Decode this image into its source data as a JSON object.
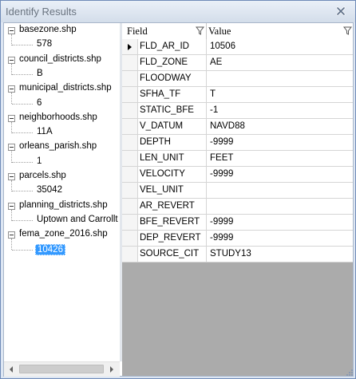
{
  "window": {
    "title": "Identify Results"
  },
  "tree": {
    "layers": [
      {
        "name": "basezone.shp",
        "value": "578"
      },
      {
        "name": "council_districts.shp",
        "value": "B"
      },
      {
        "name": "municipal_districts.shp",
        "value": "6"
      },
      {
        "name": "neighborhoods.shp",
        "value": "11A"
      },
      {
        "name": "orleans_parish.shp",
        "value": "1"
      },
      {
        "name": "parcels.shp",
        "value": "35042"
      },
      {
        "name": "planning_districts.shp",
        "value": "Uptown and Carrollt"
      },
      {
        "name": "fema_zone_2016.shp",
        "value": "10426"
      }
    ],
    "selected_index": 7
  },
  "grid": {
    "field_header": "Field",
    "value_header": "Value",
    "rows": [
      {
        "field": "FLD_AR_ID",
        "value": "10506"
      },
      {
        "field": "FLD_ZONE",
        "value": "AE"
      },
      {
        "field": "FLOODWAY",
        "value": ""
      },
      {
        "field": "SFHA_TF",
        "value": "T"
      },
      {
        "field": "STATIC_BFE",
        "value": "-1"
      },
      {
        "field": "V_DATUM",
        "value": "NAVD88"
      },
      {
        "field": "DEPTH",
        "value": "-9999"
      },
      {
        "field": "LEN_UNIT",
        "value": "FEET"
      },
      {
        "field": "VELOCITY",
        "value": "-9999"
      },
      {
        "field": "VEL_UNIT",
        "value": ""
      },
      {
        "field": "AR_REVERT",
        "value": ""
      },
      {
        "field": "BFE_REVERT",
        "value": "-9999"
      },
      {
        "field": "DEP_REVERT",
        "value": "-9999"
      },
      {
        "field": "SOURCE_CIT",
        "value": "STUDY13"
      }
    ],
    "current_row": 0
  },
  "icons": {
    "close": "close-icon",
    "filter": "filter-icon",
    "current_row": "current-row-arrow-icon",
    "scroll_left": "arrow-left-icon",
    "scroll_right": "arrow-right-icon"
  },
  "colors": {
    "selection": "#3399ff",
    "grid_background": "#ababab",
    "title_text": "#6a7480"
  }
}
